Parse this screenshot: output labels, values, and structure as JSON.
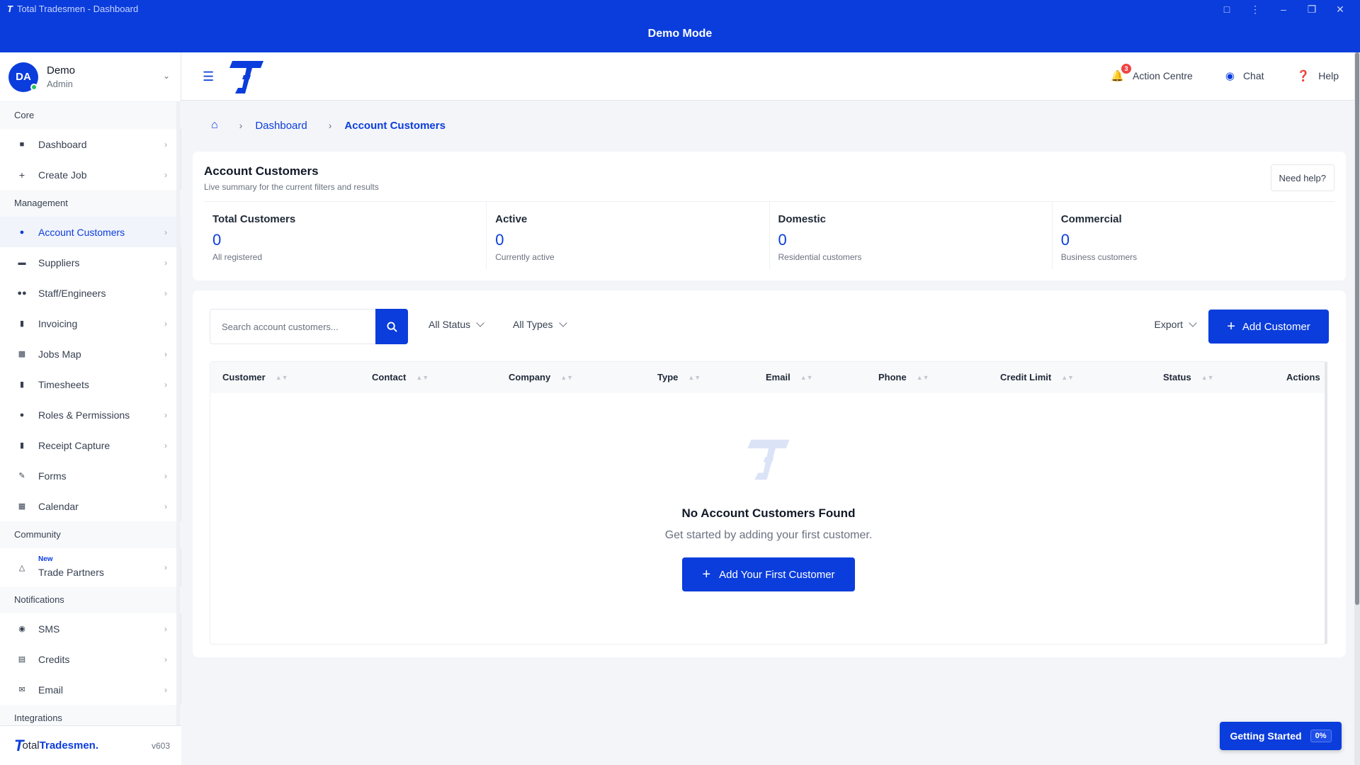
{
  "window": {
    "title": "Total Tradesmen - Dashboard",
    "banner": "Demo Mode"
  },
  "user": {
    "initials": "DA",
    "name": "Demo",
    "role": "Admin"
  },
  "sidebar": {
    "sections": {
      "core": "Core",
      "management": "Management",
      "community": "Community",
      "notifications": "Notifications",
      "integrations": "Integrations"
    },
    "items": {
      "dashboard": "Dashboard",
      "create_job": "Create Job",
      "account_customers": "Account Customers",
      "suppliers": "Suppliers",
      "staff": "Staff/Engineers",
      "invoicing": "Invoicing",
      "jobs_map": "Jobs Map",
      "timesheets": "Timesheets",
      "roles": "Roles & Permissions",
      "receipt": "Receipt Capture",
      "forms": "Forms",
      "calendar": "Calendar",
      "trade_partners": "Trade Partners",
      "trade_partners_badge": "New",
      "sms": "SMS",
      "credits": "Credits",
      "email": "Email"
    },
    "footer": {
      "brand_light": "otal",
      "brand_bold": "Tradesmen.",
      "version": "v603"
    }
  },
  "header": {
    "action_centre": "Action Centre",
    "action_badge": "3",
    "chat": "Chat",
    "help": "Help"
  },
  "breadcrumb": {
    "dashboard": "Dashboard",
    "current": "Account Customers"
  },
  "summary": {
    "title": "Account Customers",
    "subtitle": "Live summary for the current filters and results",
    "need_help": "Need help?",
    "stats": [
      {
        "label": "Total Customers",
        "value": "0",
        "desc": "All registered"
      },
      {
        "label": "Active",
        "value": "0",
        "desc": "Currently active"
      },
      {
        "label": "Domestic",
        "value": "0",
        "desc": "Residential customers"
      },
      {
        "label": "Commercial",
        "value": "0",
        "desc": "Business customers"
      }
    ]
  },
  "toolbar": {
    "search_placeholder": "Search account customers...",
    "status_filter": "All Status",
    "type_filter": "All Types",
    "export": "Export",
    "add_customer": "Add Customer"
  },
  "table": {
    "columns": [
      "Customer",
      "Contact",
      "Company",
      "Type",
      "Email",
      "Phone",
      "Credit Limit",
      "Status",
      "Actions"
    ]
  },
  "empty": {
    "title": "No Account Customers Found",
    "subtitle": "Get started by adding your first customer.",
    "button": "Add Your First Customer"
  },
  "getting_started": {
    "label": "Getting Started",
    "progress": "0%"
  },
  "colors": {
    "brand": "#0b3ddc",
    "online": "#22c55e",
    "badge": "#ef4444"
  }
}
